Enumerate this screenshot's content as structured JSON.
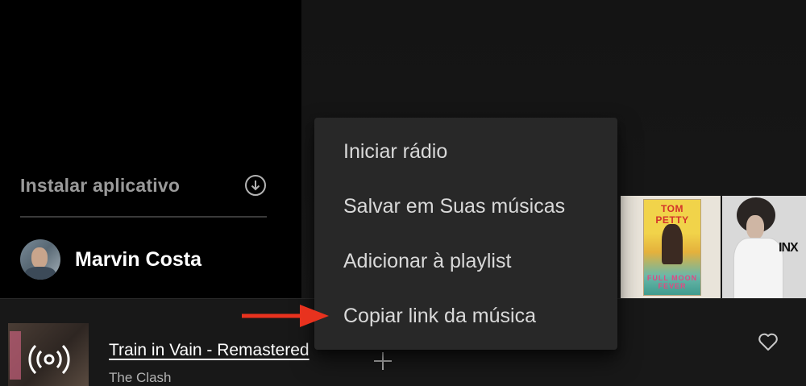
{
  "sidebar": {
    "install_label": "Instalar aplicativo",
    "install_icon": "download-circle-icon",
    "user_name": "Marvin Costa"
  },
  "albums": [
    {
      "title": "TOM PETTY",
      "subtitle": "FULL MOON FEVER"
    },
    {
      "logo_text": "INX"
    }
  ],
  "context_menu": {
    "items": [
      "Iniciar rádio",
      "Salvar em Suas músicas",
      "Adicionar à playlist",
      "Copiar link da música"
    ]
  },
  "player": {
    "track_title": "Train in Vain - Remastered",
    "artist": "The Clash",
    "cast_icon": "broadcast-icon",
    "add_icon": "plus-icon",
    "like_icon": "heart-icon"
  },
  "annotation": {
    "arrow_color": "#e8321e"
  },
  "colors": {
    "sidebar_bg": "#000000",
    "main_bg": "#121212",
    "menu_bg": "#282828",
    "player_bg": "#181818",
    "text_primary": "#ffffff",
    "text_secondary": "#b3b3b3"
  }
}
